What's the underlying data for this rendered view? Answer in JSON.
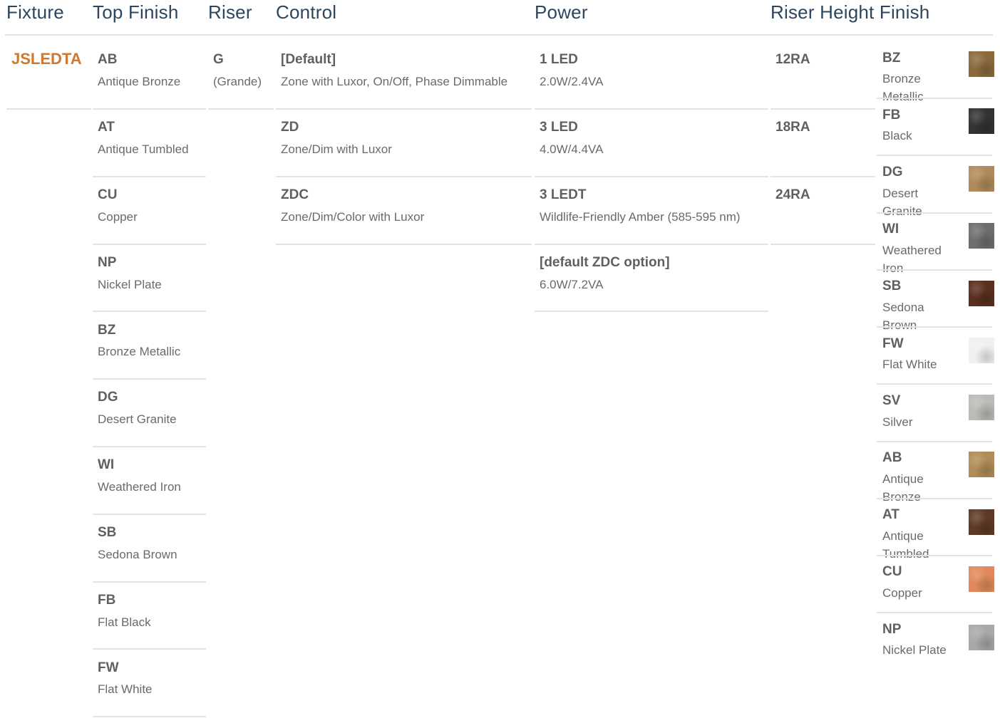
{
  "headers": {
    "fixture": "Fixture",
    "top_finish": "Top Finish",
    "riser": "Riser",
    "control": "Control",
    "power": "Power",
    "riser_height_finish": "Riser Height Finish"
  },
  "fixture": {
    "code": "JSLEDTA"
  },
  "top_finish": [
    {
      "code": "AB",
      "name": "Antique Bronze"
    },
    {
      "code": "AT",
      "name": "Antique Tumbled"
    },
    {
      "code": "CU",
      "name": "Copper"
    },
    {
      "code": "NP",
      "name": "Nickel Plate"
    },
    {
      "code": "BZ",
      "name": "Bronze Metallic"
    },
    {
      "code": "DG",
      "name": "Desert Granite"
    },
    {
      "code": "WI",
      "name": "Weathered Iron"
    },
    {
      "code": "SB",
      "name": "Sedona Brown"
    },
    {
      "code": "FB",
      "name": "Flat Black"
    },
    {
      "code": "FW",
      "name": "Flat White"
    }
  ],
  "riser": [
    {
      "code": "G",
      "name": "(Grande)"
    }
  ],
  "control": [
    {
      "code": "[Default]",
      "name": "Zone with Luxor, On/Off, Phase Dimmable"
    },
    {
      "code": "ZD",
      "name": "Zone/Dim with Luxor"
    },
    {
      "code": "ZDC",
      "name": "Zone/Dim/Color with Luxor"
    }
  ],
  "power": [
    {
      "code": "1 LED",
      "name": "2.0W/2.4VA"
    },
    {
      "code": "3 LED",
      "name": "4.0W/4.4VA"
    },
    {
      "code": "3 LEDT",
      "name": "Wildlife-Friendly Amber (585-595 nm)"
    },
    {
      "code": "[default ZDC option]",
      "name": "6.0W/7.2VA"
    }
  ],
  "riser_height": [
    {
      "code": "12RA"
    },
    {
      "code": "18RA"
    },
    {
      "code": "24RA"
    }
  ],
  "riser_finish": [
    {
      "code": "BZ",
      "line1": "Bronze",
      "line2": "Metallic",
      "swatch_icon": "bronze-texture",
      "color": "#8a6a3c"
    },
    {
      "code": "FB",
      "line1": "Black",
      "line2": "",
      "swatch_icon": "black-texture",
      "color": "#333333"
    },
    {
      "code": "DG",
      "line1": "Desert",
      "line2": "Granite",
      "swatch_icon": "granite-texture",
      "color": "#b08a5c"
    },
    {
      "code": "WI",
      "line1": "Weathered",
      "line2": "Iron",
      "swatch_icon": "iron-texture",
      "color": "#6e6e6e"
    },
    {
      "code": "SB",
      "line1": "Sedona",
      "line2": "Brown",
      "swatch_icon": "sedona-texture",
      "color": "#5a2f1f"
    },
    {
      "code": "FW",
      "line1": "Flat White",
      "line2": "",
      "swatch_icon": "white-texture",
      "color": "#f1f0ee"
    },
    {
      "code": "SV",
      "line1": "Silver",
      "line2": "",
      "swatch_icon": "silver-texture",
      "color": "#bdbbb8"
    },
    {
      "code": "AB",
      "line1": "Antique",
      "line2": "Bronze",
      "swatch_icon": "antique-bronze-texture",
      "color": "#b08c58"
    },
    {
      "code": "AT",
      "line1": "Antique",
      "line2": "Tumbled",
      "swatch_icon": "antique-tumbled-texture",
      "color": "#5e3a26"
    },
    {
      "code": "CU",
      "line1": "Copper",
      "line2": "",
      "swatch_icon": "copper-texture",
      "color": "#e08a5c"
    },
    {
      "code": "NP",
      "line1": "Nickel Plate",
      "line2": "",
      "swatch_icon": "nickel-texture",
      "color": "#a8a8a6"
    }
  ]
}
